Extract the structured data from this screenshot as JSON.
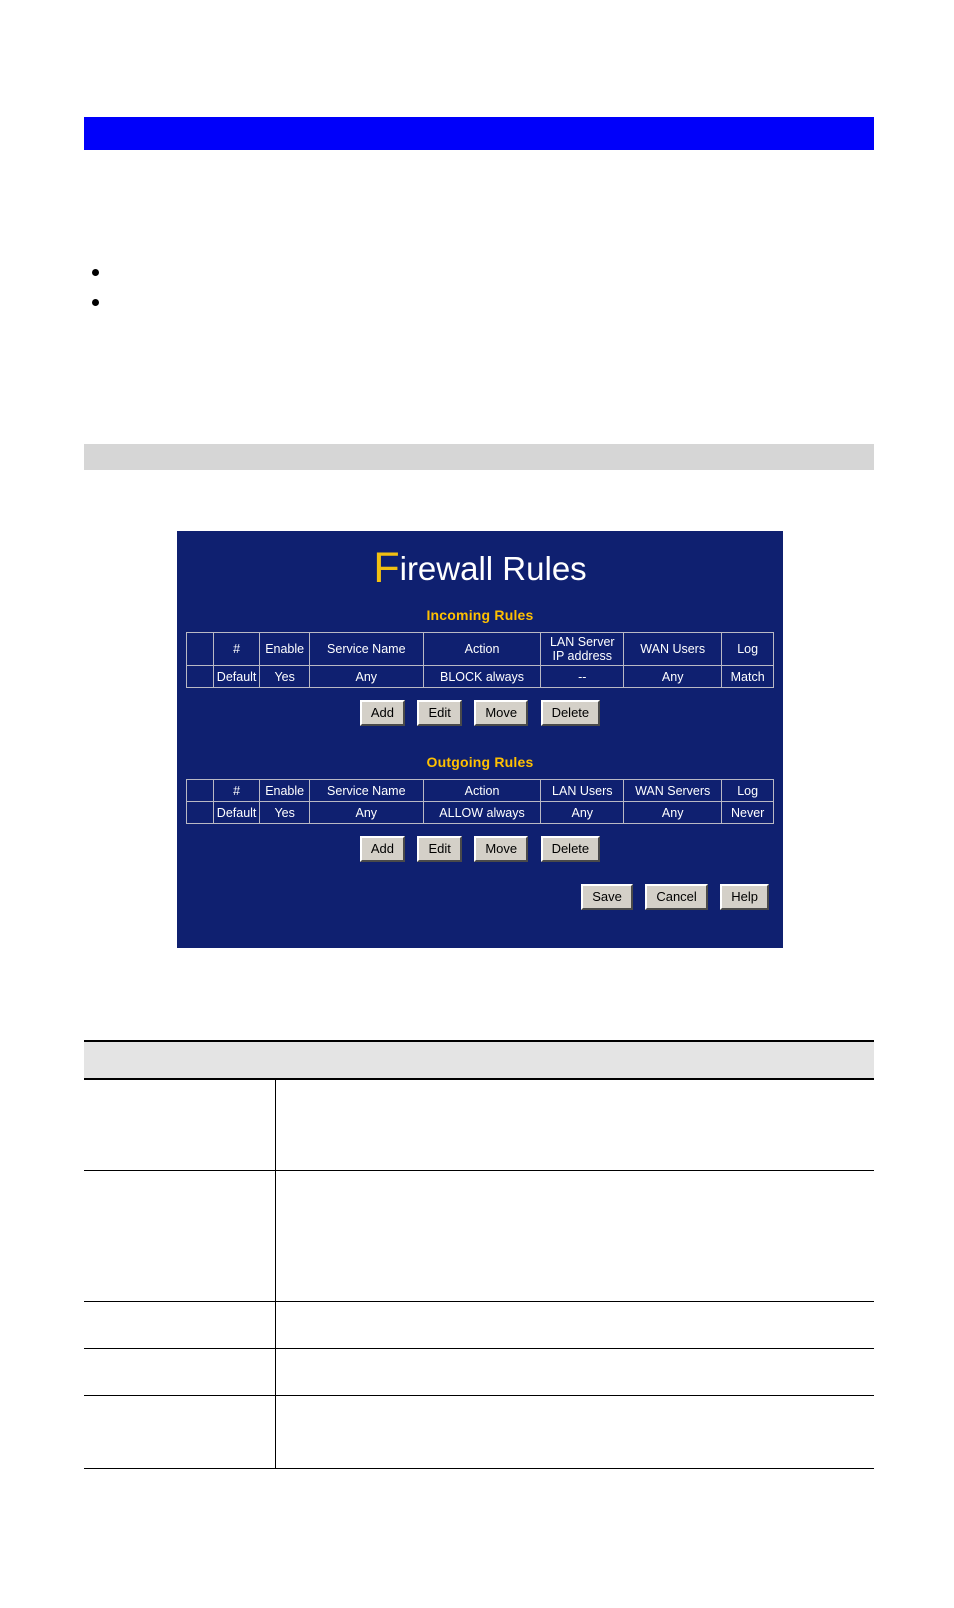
{
  "document": {
    "section_heading": "",
    "intro_paragraph": "",
    "bullets": [
      "",
      ""
    ],
    "after_bullets_paragraph": "",
    "screen_caption": ""
  },
  "router_screen": {
    "title_cap": "F",
    "title_rest": "irewall Rules",
    "colors": {
      "panel_background": "#0f2070",
      "title_cap": "#f2c012",
      "section_heading": "#ffc000",
      "table_border": "#b9b9c4",
      "button_face": "#d4d0c8"
    },
    "incoming": {
      "heading": "Incoming Rules",
      "columns": [
        "",
        "#",
        "Enable",
        "Service Name",
        "Action",
        "LAN Server IP address",
        "WAN Users",
        "Log"
      ],
      "column_lan_line1": "LAN Server",
      "column_lan_line2": "IP address",
      "rows": [
        {
          "select": "",
          "num": "Default",
          "enable": "Yes",
          "service": "Any",
          "action": "BLOCK always",
          "lan": "--",
          "wan": "Any",
          "log": "Match"
        }
      ],
      "buttons": [
        "Add",
        "Edit",
        "Move",
        "Delete"
      ]
    },
    "outgoing": {
      "heading": "Outgoing Rules",
      "columns": [
        "",
        "#",
        "Enable",
        "Service Name",
        "Action",
        "LAN Users",
        "WAN Servers",
        "Log"
      ],
      "rows": [
        {
          "select": "",
          "num": "Default",
          "enable": "Yes",
          "service": "Any",
          "action": "ALLOW always",
          "lan": "Any",
          "wan": "Any",
          "log": "Never"
        }
      ],
      "buttons": [
        "Add",
        "Edit",
        "Move",
        "Delete"
      ]
    },
    "footer_buttons": [
      "Save",
      "Cancel",
      "Help"
    ]
  },
  "data_table": {
    "header": [
      "",
      ""
    ],
    "rows": [
      {
        "label": "",
        "value": ""
      },
      {
        "label": "",
        "value": ""
      },
      {
        "label": "",
        "value": ""
      },
      {
        "label": "",
        "value": ""
      },
      {
        "label": "",
        "value": ""
      }
    ]
  }
}
